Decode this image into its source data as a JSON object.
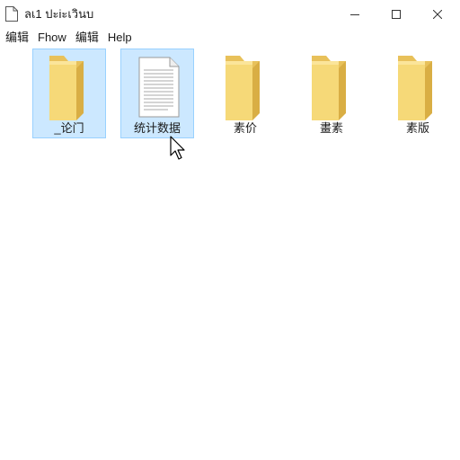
{
  "window": {
    "title": "ลเ1 ปะiะเวินบ",
    "title_icon": "document-icon"
  },
  "controls": {
    "minimize_icon": "minimize-icon",
    "maximize_icon": "maximize-icon",
    "close_icon": "close-icon"
  },
  "menu": [
    {
      "label": "编辑"
    },
    {
      "label": "Fhow"
    },
    {
      "label": "编辑"
    },
    {
      "label": "Help"
    }
  ],
  "files": [
    {
      "label": "_论门",
      "icon": "folder-icon",
      "selected": true
    },
    {
      "label": "统计数据",
      "icon": "text-document-icon",
      "selected": true
    },
    {
      "label": "素价",
      "icon": "folder-icon",
      "selected": false
    },
    {
      "label": "畫素",
      "icon": "folder-icon",
      "selected": false
    },
    {
      "label": "素版",
      "icon": "folder-icon",
      "selected": false
    }
  ],
  "colors": {
    "selection_fill": "#cce8ff",
    "selection_border": "#99d1ff",
    "folder_front": "#f6d978",
    "folder_back": "#e8c15a"
  },
  "pointer": "arrow-cursor-icon"
}
